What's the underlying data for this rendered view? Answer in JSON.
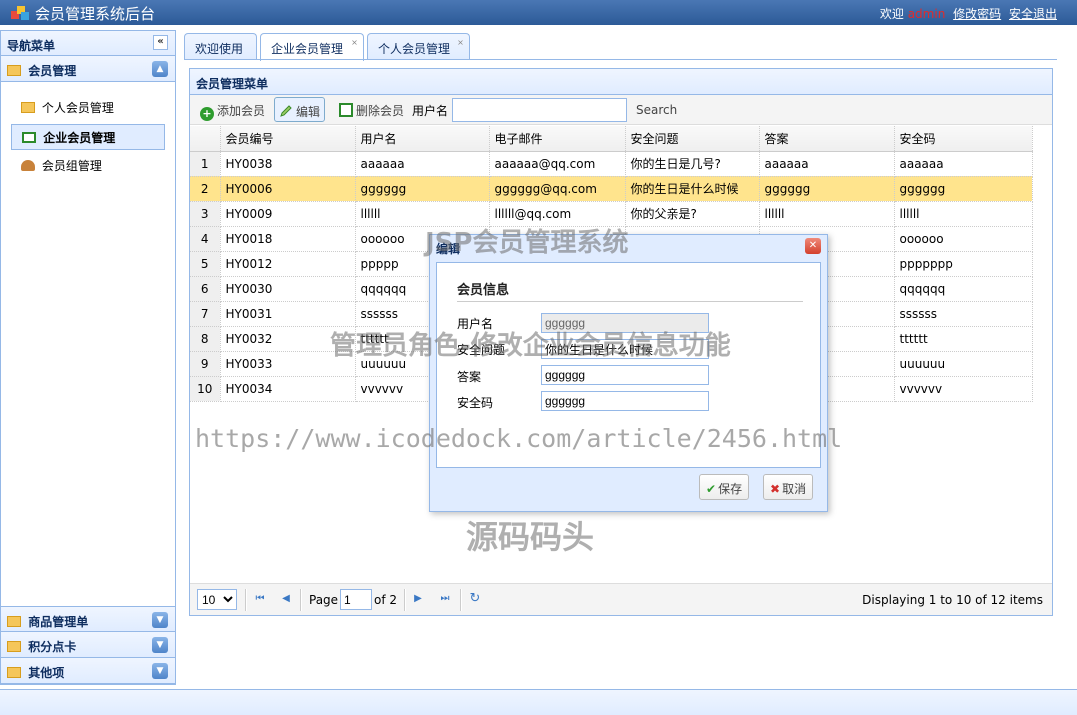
{
  "header": {
    "title": "会员管理系统后台",
    "welcome": "欢迎",
    "user": "admin",
    "change_password": "修改密码",
    "logout": "安全退出"
  },
  "nav": {
    "title": "导航菜单",
    "sections": [
      {
        "label": "会员管理",
        "expanded": true,
        "items": [
          {
            "label": "个人会员管理",
            "icon": "folder-icon"
          },
          {
            "label": "企业会员管理",
            "icon": "card-icon",
            "selected": true
          },
          {
            "label": "会员组管理",
            "icon": "user-icon"
          }
        ]
      },
      {
        "label": "商品管理单"
      },
      {
        "label": "积分点卡"
      },
      {
        "label": "其他项"
      }
    ]
  },
  "tabs": [
    {
      "label": "欢迎使用",
      "closable": false
    },
    {
      "label": "企业会员管理",
      "closable": true,
      "active": true
    },
    {
      "label": "个人会员管理",
      "closable": true
    }
  ],
  "panel": {
    "title": "会员管理菜单",
    "toolbar": {
      "add": "添加会员",
      "edit": "编辑",
      "delete": "删除会员",
      "username_label": "用户名",
      "search": "Search"
    }
  },
  "grid": {
    "columns": [
      "会员编号",
      "用户名",
      "电子邮件",
      "安全问题",
      "答案",
      "安全码"
    ],
    "rows": [
      {
        "n": "1",
        "id": "HY0038",
        "user": "aaaaaa",
        "email": "aaaaaa@qq.com",
        "question": "你的生日是几号?",
        "answer": "aaaaaa",
        "code": "aaaaaa"
      },
      {
        "n": "2",
        "id": "HY0006",
        "user": "gggggg",
        "email": "gggggg@qq.com",
        "question": "你的生日是什么时候",
        "answer": "gggggg",
        "code": "gggggg",
        "selected": true
      },
      {
        "n": "3",
        "id": "HY0009",
        "user": "llllll",
        "email": "llllll@qq.com",
        "question": "你的父亲是?",
        "answer": "llllll",
        "code": "llllll"
      },
      {
        "n": "4",
        "id": "HY0018",
        "user": "oooooo",
        "email": "",
        "question": "",
        "answer": "",
        "code": "oooooo"
      },
      {
        "n": "5",
        "id": "HY0012",
        "user": "ppppp",
        "email": "",
        "question": "",
        "answer": "",
        "code": "ppppppp"
      },
      {
        "n": "6",
        "id": "HY0030",
        "user": "qqqqqq",
        "email": "",
        "question": "",
        "answer": "",
        "code": "qqqqqq"
      },
      {
        "n": "7",
        "id": "HY0031",
        "user": "ssssss",
        "email": "",
        "question": "",
        "answer": "",
        "code": "ssssss"
      },
      {
        "n": "8",
        "id": "HY0032",
        "user": "tttttt",
        "email": "",
        "question": "",
        "answer": "",
        "code": "tttttt"
      },
      {
        "n": "9",
        "id": "HY0033",
        "user": "uuuuuu",
        "email": "",
        "question": "",
        "answer": "",
        "code": "uuuuuu"
      },
      {
        "n": "10",
        "id": "HY0034",
        "user": "vvvvvv",
        "email": "",
        "question": "",
        "answer": "",
        "code": "vvvvvv"
      }
    ]
  },
  "pager": {
    "page_size": "10",
    "page_label": "Page",
    "page": "1",
    "of_label": "of 2",
    "info": "Displaying 1 to 10 of 12 items"
  },
  "dialog": {
    "title": "编辑",
    "section": "会员信息",
    "fields": {
      "username": {
        "label": "用户名",
        "value": "gggggg"
      },
      "question": {
        "label": "安全问题",
        "value": "你的生日是什么时候"
      },
      "answer": {
        "label": "答案",
        "value": "gggggg"
      },
      "code": {
        "label": "安全码",
        "value": "gggggg"
      }
    },
    "save": "保存",
    "cancel": "取消"
  },
  "watermarks": {
    "top": "JSP会员管理系统",
    "middle": "管理员角色-修改企业会员信息功能",
    "url": "https://www.icodedock.com/article/2456.html",
    "bottom": "源码码头"
  },
  "colors": {
    "header_bg": "#2c5a97",
    "panel_border": "#95b8e7",
    "selected_row": "#ffe48d",
    "user_name": "#e02b2b"
  }
}
